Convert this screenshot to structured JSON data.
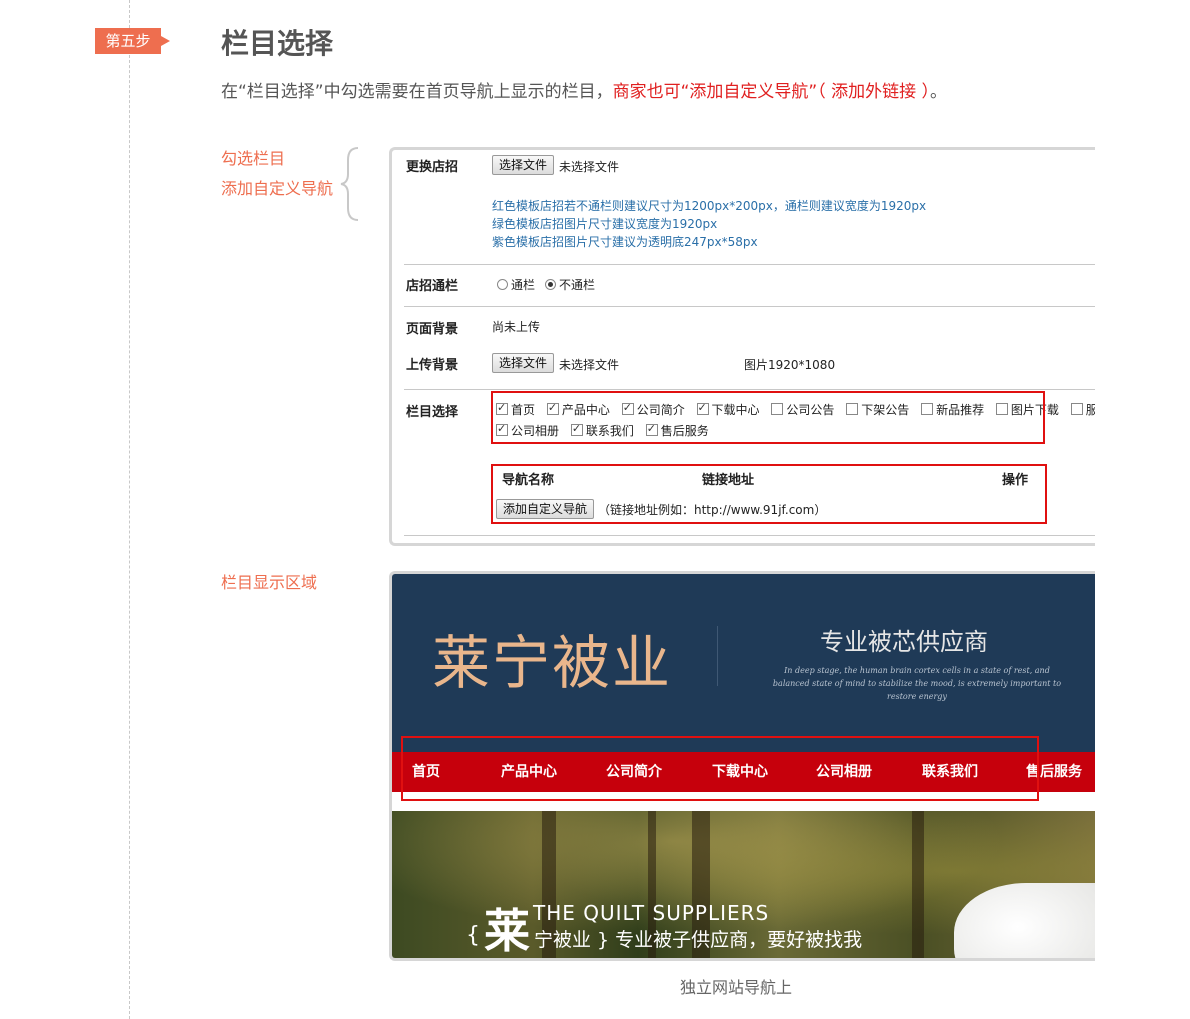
{
  "step": {
    "badge": "第五步",
    "title": "栏目选择"
  },
  "intro": {
    "part1": "在“栏目选择”中勾选需要在首页导航上显示的栏目，",
    "part2": "商家也可“添加自定义导航”（ 添加外链接 ）",
    "part3": "。"
  },
  "side_labels": {
    "check_columns": "勾选栏目",
    "add_custom_nav": "添加自定义导航",
    "display_area": "栏目显示区域"
  },
  "form": {
    "change_sign": {
      "label": "更换店招",
      "button": "选择文件",
      "status": "未选择文件",
      "tips": [
        "红色模板店招若不通栏则建议尺寸为1200px*200px，通栏则建议宽度为1920px",
        "绿色模板店招图片尺寸建议宽度为1920px",
        "紫色模板店招图片尺寸建议为透明底247px*58px"
      ]
    },
    "sign_banner": {
      "label": "店招通栏",
      "options": [
        "通栏",
        "不通栏"
      ],
      "selected": "不通栏"
    },
    "page_bg": {
      "label": "页面背景",
      "value": "尚未上传"
    },
    "upload_bg": {
      "label": "上传背景",
      "button": "选择文件",
      "status": "未选择文件",
      "size_hint": "图片1920*1080"
    },
    "columns": {
      "label": "栏目选择",
      "row1": [
        {
          "name": "首页",
          "checked": true
        },
        {
          "name": "产品中心",
          "checked": true
        },
        {
          "name": "公司简介",
          "checked": true
        },
        {
          "name": "下载中心",
          "checked": true
        },
        {
          "name": "公司公告",
          "checked": false
        },
        {
          "name": "下架公告",
          "checked": false
        },
        {
          "name": "新品推荐",
          "checked": false
        },
        {
          "name": "图片下载",
          "checked": false
        },
        {
          "name": "服",
          "checked": false
        }
      ],
      "row2": [
        {
          "name": "公司相册",
          "checked": true
        },
        {
          "name": "联系我们",
          "checked": true
        },
        {
          "name": "售后服务",
          "checked": true
        }
      ]
    },
    "custom_nav": {
      "col_name": "导航名称",
      "col_link": "链接地址",
      "col_action": "操作",
      "add_button": "添加自定义导航",
      "example": "（链接地址例如：http://www.91jf.com）"
    }
  },
  "banner": {
    "logo": "莱宁被业",
    "slogan": "专业被芯供应商",
    "slogan_en": "In deep stage, the human brain cortex cells in a state of rest, and balanced state of mind to stabilize the mood, is extremely important to restore energy",
    "nav": [
      "首页",
      "产品中心",
      "公司简介",
      "下载中心",
      "公司相册",
      "联系我们",
      "售后服务"
    ],
    "photo_brace": "{",
    "photo_big_char": "莱",
    "photo_en": "THE QUILT SUPPLIERS",
    "photo_cn": "宁被业 } 专业被子供应商，要好被找我"
  },
  "caption": "独立网站导航上",
  "colors": {
    "accent": "#ee6e4f",
    "highlight": "#e01010",
    "nav_red": "#c6000c",
    "banner_navy": "#1f3a57",
    "tip_blue": "#2a6fa8"
  }
}
